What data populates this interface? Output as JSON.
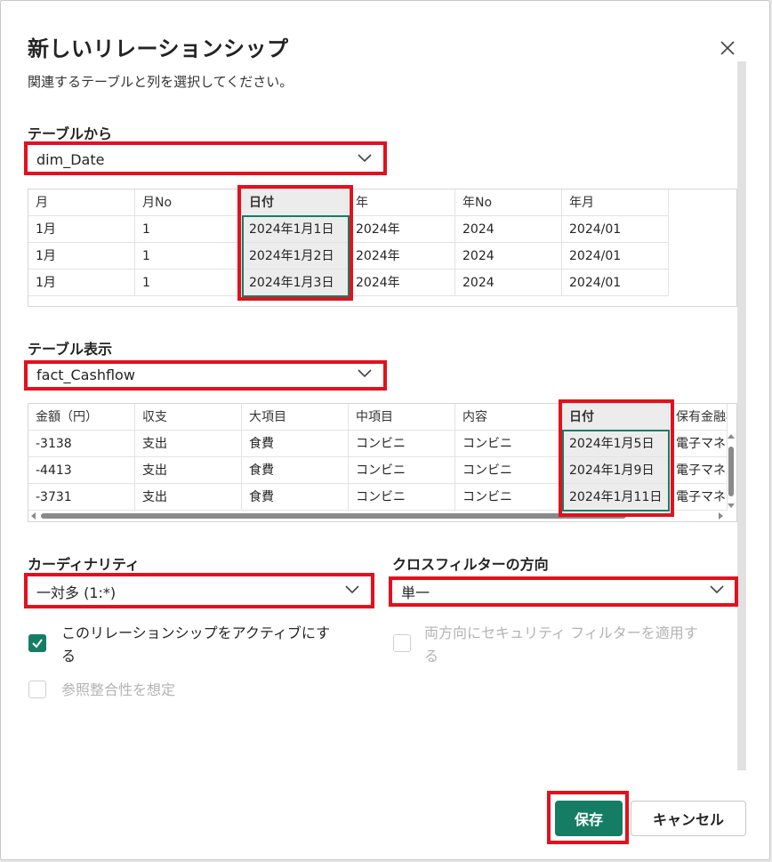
{
  "dialog": {
    "title": "新しいリレーションシップ",
    "subtitle": "関連するテーブルと列を選択してください。"
  },
  "from_table": {
    "label": "テーブルから",
    "selected": "dim_Date",
    "headers": [
      "月",
      "月No",
      "日付",
      "年",
      "年No",
      "年月"
    ],
    "rows": [
      [
        "1月",
        "1",
        "2024年1月1日",
        "2024年",
        "2024",
        "2024/01"
      ],
      [
        "1月",
        "1",
        "2024年1月2日",
        "2024年",
        "2024",
        "2024/01"
      ],
      [
        "1月",
        "1",
        "2024年1月3日",
        "2024年",
        "2024",
        "2024/01"
      ]
    ]
  },
  "to_table": {
    "label": "テーブル表示",
    "selected": "fact_Cashflow",
    "headers": [
      "金額（円）",
      "収支",
      "大項目",
      "中項目",
      "内容",
      "日付",
      "保有金融機"
    ],
    "rows": [
      [
        "-3138",
        "支出",
        "食費",
        "コンビニ",
        "コンビニ",
        "2024年1月5日",
        "電子マネ"
      ],
      [
        "-4413",
        "支出",
        "食費",
        "コンビニ",
        "コンビニ",
        "2024年1月9日",
        "電子マネ"
      ],
      [
        "-3731",
        "支出",
        "食費",
        "コンビニ",
        "コンビニ",
        "2024年1月11日",
        "電子マネ"
      ]
    ]
  },
  "cardinality": {
    "label": "カーディナリティ",
    "selected": "一対多 (1:*)"
  },
  "cross_filter": {
    "label": "クロスフィルターの方向",
    "selected": "単一"
  },
  "options": {
    "active_line1": "このリレーションシップをアクティブにす",
    "active_line2": "る",
    "referential": "参照整合性を想定",
    "security_line1": "両方向にセキュリティ フィルターを適用す",
    "security_line2": "る"
  },
  "buttons": {
    "save": "保存",
    "cancel": "キャンセル"
  },
  "colors": {
    "accent": "#147d64",
    "highlight": "#e3101d"
  }
}
